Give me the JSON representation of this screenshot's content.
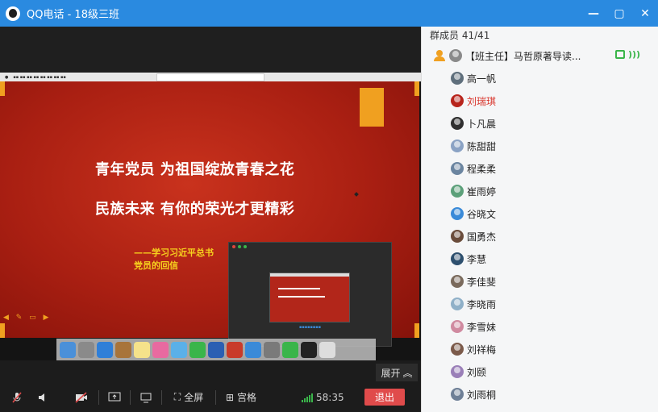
{
  "window": {
    "title": "QQ电话 - 18级三班",
    "controls": {
      "minimize": "—",
      "maximize": "▢",
      "close": "✕"
    }
  },
  "slide": {
    "line1": "青年党员  为祖国绽放青春之花",
    "line2": "民族未来  有你的荣光才更精彩",
    "sub1": "——学习习近平总书",
    "sub2": "党员的回信"
  },
  "expand_button": {
    "label": "展开"
  },
  "controls": {
    "fullscreen_label": "全屏",
    "grid_label": "宫格",
    "timer": "58:35",
    "exit_label": "退出"
  },
  "members": {
    "header": "群成员 41/41",
    "leader": {
      "name": "【班主任】马哲原著导读..."
    },
    "list": [
      {
        "name": "高一帆",
        "avatar_color": "#5f6f7c"
      },
      {
        "name": "刘瑞琪",
        "avatar_color": "#b7241c",
        "highlight": true
      },
      {
        "name": "卜凡晨",
        "avatar_color": "#2f2f2f"
      },
      {
        "name": "陈甜甜",
        "avatar_color": "#8aa2c4"
      },
      {
        "name": "程柔柔",
        "avatar_color": "#6b85a0"
      },
      {
        "name": "崔雨婷",
        "avatar_color": "#5ca07a"
      },
      {
        "name": "谷晓文",
        "avatar_color": "#3a8ad8"
      },
      {
        "name": "国勇杰",
        "avatar_color": "#6a4c3b"
      },
      {
        "name": "李慧",
        "avatar_color": "#2d4f6e"
      },
      {
        "name": "李佳斐",
        "avatar_color": "#7a6a5c"
      },
      {
        "name": "李晓雨",
        "avatar_color": "#8fb0c8"
      },
      {
        "name": "李雪妹",
        "avatar_color": "#d08aa0"
      },
      {
        "name": "刘祥梅",
        "avatar_color": "#7b5a4a"
      },
      {
        "name": "刘颐",
        "avatar_color": "#9a7fb8"
      },
      {
        "name": "刘雨桐",
        "avatar_color": "#6e7f96"
      }
    ]
  },
  "colors": {
    "titlebar": "#2a8ae0",
    "exit": "#e04b4b",
    "signal": "#3ab54a",
    "highlight_name": "#d9342b"
  }
}
